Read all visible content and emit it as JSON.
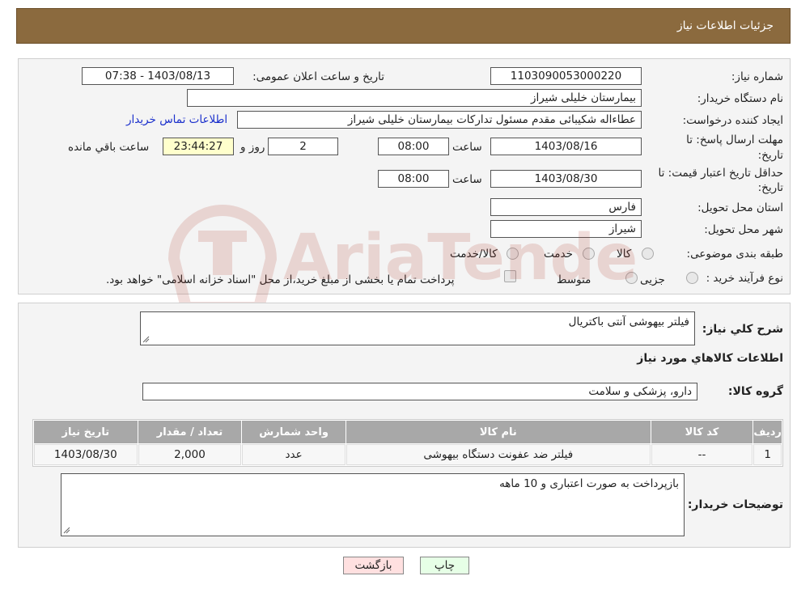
{
  "header": {
    "title": "جزئیات اطلاعات نیاز"
  },
  "form": {
    "need_number_label": "شماره نیاز:",
    "need_number": "1103090053000220",
    "announce_label": "تاریخ و ساعت اعلان عمومی:",
    "announce_value": "1403/08/13 - 07:38",
    "buyer_org_label": "نام دستگاه خریدار:",
    "buyer_org": "بیمارستان خلیلی شیراز",
    "creator_label": "ایجاد کننده درخواست:",
    "creator": "عطاءاله شکیبائی مقدم مسئول تدارکات  بیمارستان خلیلی شیراز",
    "contact_link": "اطلاعات تماس خریدار",
    "deadline_label_1": "مهلت ارسال پاسخ: تا",
    "deadline_label_2": "تاریخ:",
    "deadline_date": "1403/08/16",
    "time_label": "ساعت",
    "deadline_time": "08:00",
    "days_value": "2",
    "days_label": "روز و",
    "remaining_time": "23:44:27",
    "remaining_label": "ساعت باقي مانده",
    "validity_label_1": "حداقل تاریخ اعتبار قیمت: تا",
    "validity_label_2": "تاریخ:",
    "validity_date": "1403/08/30",
    "validity_time": "08:00",
    "province_label": "استان محل تحویل:",
    "province": "فارس",
    "city_label": "شهر محل تحویل:",
    "city": "شیراز",
    "category_label": "طبقه بندی موضوعی:",
    "category_options": [
      "کالا",
      "خدمت",
      "کالا/خدمت"
    ],
    "process_label": "نوع فرآیند خرید :",
    "process_options": [
      "جزیی",
      "متوسط"
    ],
    "process_note": "پرداخت تمام یا بخشی از مبلغ خرید،از محل \"اسناد خزانه اسلامی\" خواهد بود."
  },
  "details": {
    "summary_label": "شرح کلي نياز:",
    "summary": "فیلتر بیهوشی آنتی باکتریال",
    "goods_info_title": "اطلاعات کالاهاي مورد نياز",
    "group_label": "گروه کالا:",
    "group": "دارو، پزشکی و سلامت",
    "table": {
      "headers": [
        "رديف",
        "کد کالا",
        "نام کالا",
        "واحد شمارش",
        "تعداد / مقدار",
        "تاریخ نیاز"
      ],
      "rows": [
        [
          "1",
          "--",
          "فیلتر ضد عفونت دستگاه بیهوشی",
          "عدد",
          "2,000",
          "1403/08/30"
        ]
      ]
    },
    "buyer_notes_label": "توضیحات خریدار:",
    "buyer_notes": "بازپرداخت به صورت اعتباری و 10 ماهه"
  },
  "buttons": {
    "print": "چاپ",
    "back": "بازگشت"
  },
  "watermark_text": "AriaTender.neT",
  "colors": {
    "header": "#8b6a3e",
    "link": "#1a2fcc",
    "table_header": "#a8a8a8"
  }
}
